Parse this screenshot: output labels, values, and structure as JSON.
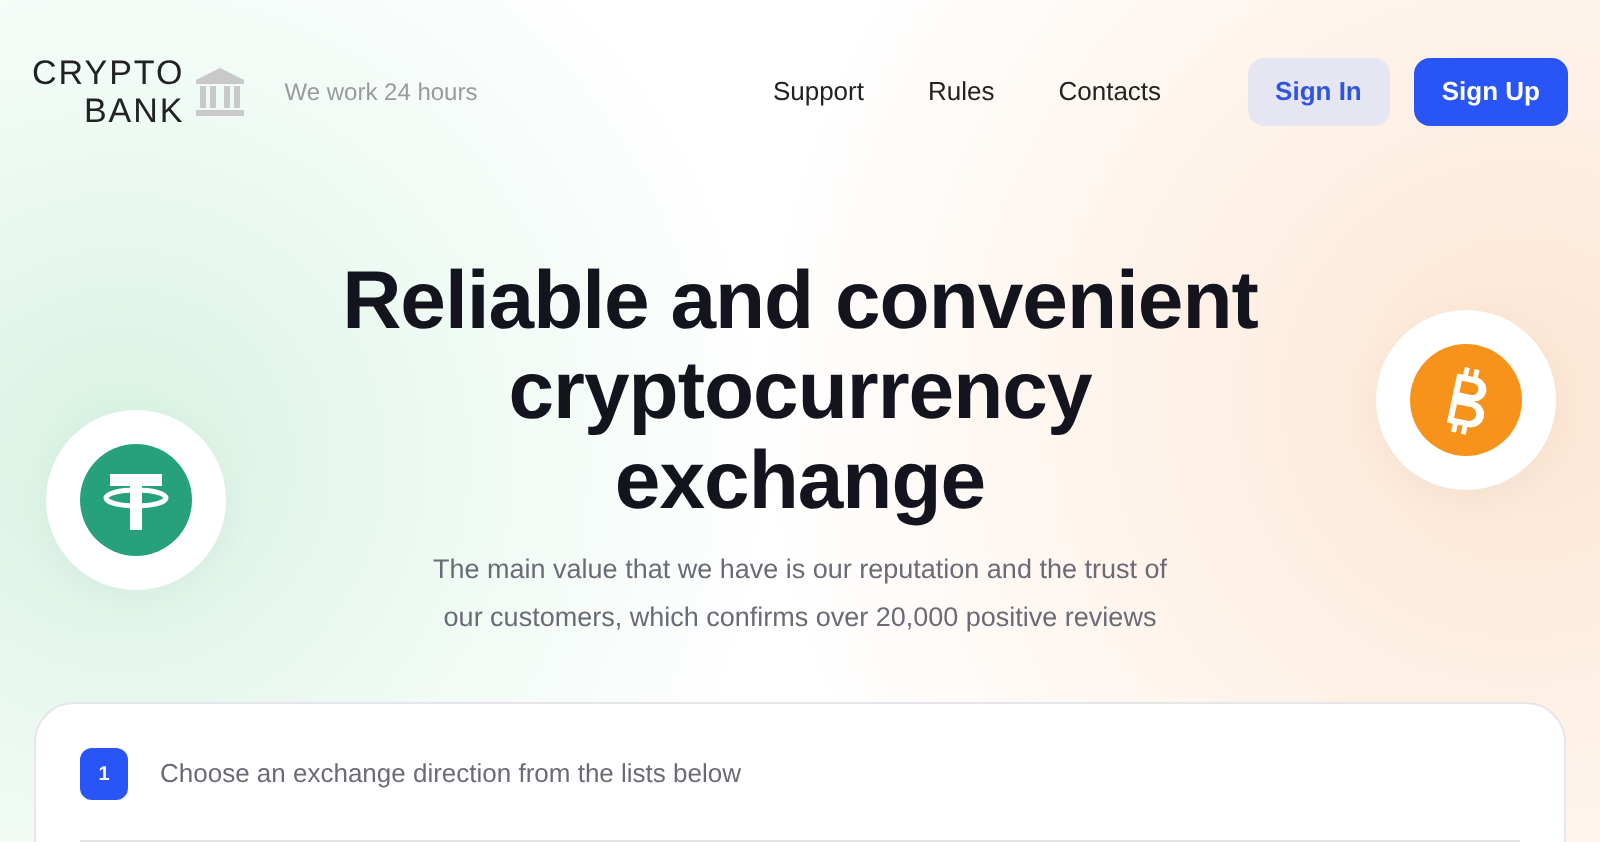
{
  "logo": {
    "line_1": "CRYPTO",
    "line_2": "BANK"
  },
  "tagline": "We work 24 hours",
  "nav": [
    "Support",
    "Rules",
    "Contacts"
  ],
  "buttons": [
    {
      "label": "Sign In",
      "kind": "secondary"
    },
    {
      "label": "Sign Up",
      "kind": "primary"
    }
  ],
  "hero": {
    "title_lines": [
      "Reliable and convenient",
      "cryptocurrency",
      "exchange"
    ],
    "subtitle_lines": [
      "The main value that we have is our reputation and the trust of",
      "our customers, which confirms over 20,000 positive reviews"
    ]
  },
  "steps": [
    {
      "number": "1",
      "text": "Choose an exchange direction from the lists below"
    }
  ]
}
